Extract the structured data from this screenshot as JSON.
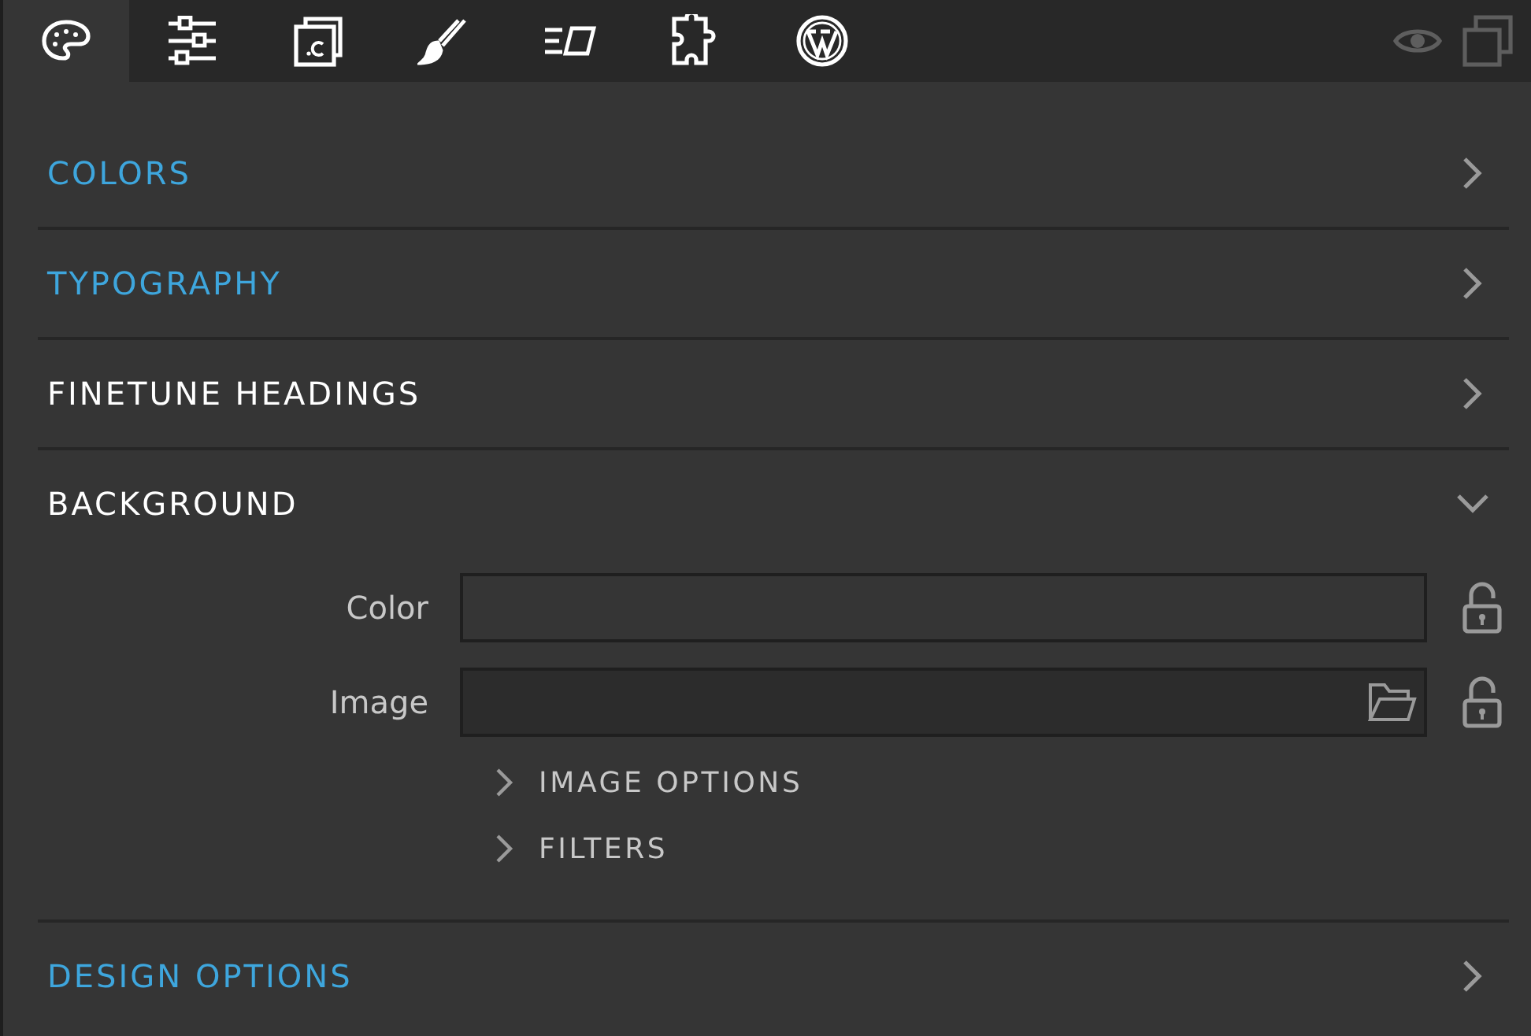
{
  "toolbar": {
    "tabs": [
      {
        "selected": true
      },
      {
        "selected": false
      },
      {
        "selected": false
      },
      {
        "selected": false
      },
      {
        "selected": false
      },
      {
        "selected": false
      },
      {
        "selected": false
      }
    ]
  },
  "sections": [
    {
      "title": "COLORS",
      "highlighted": true,
      "expanded": false
    },
    {
      "title": "TYPOGRAPHY",
      "highlighted": true,
      "expanded": false
    },
    {
      "title": "FINETUNE HEADINGS",
      "highlighted": false,
      "expanded": false
    },
    {
      "title": "BACKGROUND",
      "highlighted": false,
      "expanded": true,
      "fields": [
        {
          "label": "Color",
          "kind": "text",
          "locked": false
        },
        {
          "label": "Image",
          "kind": "file",
          "locked": false
        }
      ],
      "subsections": [
        {
          "title": "IMAGE OPTIONS",
          "expanded": false
        },
        {
          "title": "FILTERS",
          "expanded": false
        }
      ]
    },
    {
      "title": "DESIGN OPTIONS",
      "highlighted": true,
      "expanded": false
    }
  ]
}
